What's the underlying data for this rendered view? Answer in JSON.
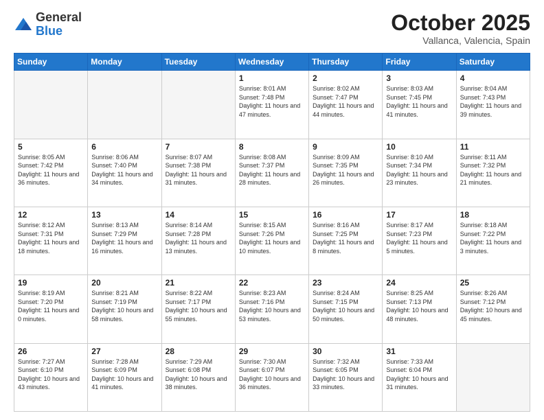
{
  "logo": {
    "general": "General",
    "blue": "Blue"
  },
  "header": {
    "month": "October 2025",
    "location": "Vallanca, Valencia, Spain"
  },
  "weekdays": [
    "Sunday",
    "Monday",
    "Tuesday",
    "Wednesday",
    "Thursday",
    "Friday",
    "Saturday"
  ],
  "weeks": [
    [
      {
        "day": "",
        "sunrise": "",
        "sunset": "",
        "daylight": ""
      },
      {
        "day": "",
        "sunrise": "",
        "sunset": "",
        "daylight": ""
      },
      {
        "day": "",
        "sunrise": "",
        "sunset": "",
        "daylight": ""
      },
      {
        "day": "1",
        "sunrise": "Sunrise: 8:01 AM",
        "sunset": "Sunset: 7:48 PM",
        "daylight": "Daylight: 11 hours and 47 minutes."
      },
      {
        "day": "2",
        "sunrise": "Sunrise: 8:02 AM",
        "sunset": "Sunset: 7:47 PM",
        "daylight": "Daylight: 11 hours and 44 minutes."
      },
      {
        "day": "3",
        "sunrise": "Sunrise: 8:03 AM",
        "sunset": "Sunset: 7:45 PM",
        "daylight": "Daylight: 11 hours and 41 minutes."
      },
      {
        "day": "4",
        "sunrise": "Sunrise: 8:04 AM",
        "sunset": "Sunset: 7:43 PM",
        "daylight": "Daylight: 11 hours and 39 minutes."
      }
    ],
    [
      {
        "day": "5",
        "sunrise": "Sunrise: 8:05 AM",
        "sunset": "Sunset: 7:42 PM",
        "daylight": "Daylight: 11 hours and 36 minutes."
      },
      {
        "day": "6",
        "sunrise": "Sunrise: 8:06 AM",
        "sunset": "Sunset: 7:40 PM",
        "daylight": "Daylight: 11 hours and 34 minutes."
      },
      {
        "day": "7",
        "sunrise": "Sunrise: 8:07 AM",
        "sunset": "Sunset: 7:38 PM",
        "daylight": "Daylight: 11 hours and 31 minutes."
      },
      {
        "day": "8",
        "sunrise": "Sunrise: 8:08 AM",
        "sunset": "Sunset: 7:37 PM",
        "daylight": "Daylight: 11 hours and 28 minutes."
      },
      {
        "day": "9",
        "sunrise": "Sunrise: 8:09 AM",
        "sunset": "Sunset: 7:35 PM",
        "daylight": "Daylight: 11 hours and 26 minutes."
      },
      {
        "day": "10",
        "sunrise": "Sunrise: 8:10 AM",
        "sunset": "Sunset: 7:34 PM",
        "daylight": "Daylight: 11 hours and 23 minutes."
      },
      {
        "day": "11",
        "sunrise": "Sunrise: 8:11 AM",
        "sunset": "Sunset: 7:32 PM",
        "daylight": "Daylight: 11 hours and 21 minutes."
      }
    ],
    [
      {
        "day": "12",
        "sunrise": "Sunrise: 8:12 AM",
        "sunset": "Sunset: 7:31 PM",
        "daylight": "Daylight: 11 hours and 18 minutes."
      },
      {
        "day": "13",
        "sunrise": "Sunrise: 8:13 AM",
        "sunset": "Sunset: 7:29 PM",
        "daylight": "Daylight: 11 hours and 16 minutes."
      },
      {
        "day": "14",
        "sunrise": "Sunrise: 8:14 AM",
        "sunset": "Sunset: 7:28 PM",
        "daylight": "Daylight: 11 hours and 13 minutes."
      },
      {
        "day": "15",
        "sunrise": "Sunrise: 8:15 AM",
        "sunset": "Sunset: 7:26 PM",
        "daylight": "Daylight: 11 hours and 10 minutes."
      },
      {
        "day": "16",
        "sunrise": "Sunrise: 8:16 AM",
        "sunset": "Sunset: 7:25 PM",
        "daylight": "Daylight: 11 hours and 8 minutes."
      },
      {
        "day": "17",
        "sunrise": "Sunrise: 8:17 AM",
        "sunset": "Sunset: 7:23 PM",
        "daylight": "Daylight: 11 hours and 5 minutes."
      },
      {
        "day": "18",
        "sunrise": "Sunrise: 8:18 AM",
        "sunset": "Sunset: 7:22 PM",
        "daylight": "Daylight: 11 hours and 3 minutes."
      }
    ],
    [
      {
        "day": "19",
        "sunrise": "Sunrise: 8:19 AM",
        "sunset": "Sunset: 7:20 PM",
        "daylight": "Daylight: 11 hours and 0 minutes."
      },
      {
        "day": "20",
        "sunrise": "Sunrise: 8:21 AM",
        "sunset": "Sunset: 7:19 PM",
        "daylight": "Daylight: 10 hours and 58 minutes."
      },
      {
        "day": "21",
        "sunrise": "Sunrise: 8:22 AM",
        "sunset": "Sunset: 7:17 PM",
        "daylight": "Daylight: 10 hours and 55 minutes."
      },
      {
        "day": "22",
        "sunrise": "Sunrise: 8:23 AM",
        "sunset": "Sunset: 7:16 PM",
        "daylight": "Daylight: 10 hours and 53 minutes."
      },
      {
        "day": "23",
        "sunrise": "Sunrise: 8:24 AM",
        "sunset": "Sunset: 7:15 PM",
        "daylight": "Daylight: 10 hours and 50 minutes."
      },
      {
        "day": "24",
        "sunrise": "Sunrise: 8:25 AM",
        "sunset": "Sunset: 7:13 PM",
        "daylight": "Daylight: 10 hours and 48 minutes."
      },
      {
        "day": "25",
        "sunrise": "Sunrise: 8:26 AM",
        "sunset": "Sunset: 7:12 PM",
        "daylight": "Daylight: 10 hours and 45 minutes."
      }
    ],
    [
      {
        "day": "26",
        "sunrise": "Sunrise: 7:27 AM",
        "sunset": "Sunset: 6:10 PM",
        "daylight": "Daylight: 10 hours and 43 minutes."
      },
      {
        "day": "27",
        "sunrise": "Sunrise: 7:28 AM",
        "sunset": "Sunset: 6:09 PM",
        "daylight": "Daylight: 10 hours and 41 minutes."
      },
      {
        "day": "28",
        "sunrise": "Sunrise: 7:29 AM",
        "sunset": "Sunset: 6:08 PM",
        "daylight": "Daylight: 10 hours and 38 minutes."
      },
      {
        "day": "29",
        "sunrise": "Sunrise: 7:30 AM",
        "sunset": "Sunset: 6:07 PM",
        "daylight": "Daylight: 10 hours and 36 minutes."
      },
      {
        "day": "30",
        "sunrise": "Sunrise: 7:32 AM",
        "sunset": "Sunset: 6:05 PM",
        "daylight": "Daylight: 10 hours and 33 minutes."
      },
      {
        "day": "31",
        "sunrise": "Sunrise: 7:33 AM",
        "sunset": "Sunset: 6:04 PM",
        "daylight": "Daylight: 10 hours and 31 minutes."
      },
      {
        "day": "",
        "sunrise": "",
        "sunset": "",
        "daylight": ""
      }
    ]
  ]
}
